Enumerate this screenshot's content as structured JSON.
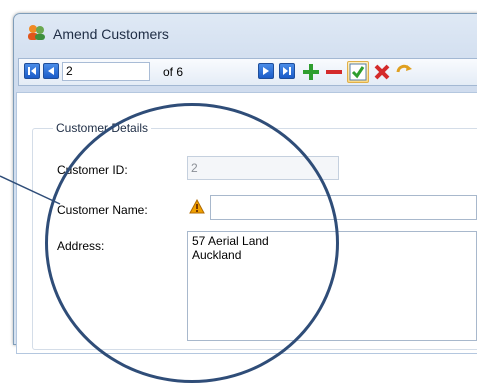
{
  "window": {
    "title": "Amend Customers"
  },
  "navigator": {
    "current_record": "2",
    "record_count_label": "of 6",
    "buttons": {
      "first": "first-record",
      "previous": "previous-record",
      "next": "next-record",
      "last": "last-record",
      "add": "add-record",
      "delete": "delete-record",
      "post": "post-edit",
      "cancel": "cancel-edit"
    }
  },
  "customer_details": {
    "group_title": "Customer Details",
    "id_label": "Customer ID:",
    "id_value": "2",
    "name_label": "Customer Name:",
    "name_value": "",
    "address_label": "Address:",
    "address_lines": [
      "57 Aerial Land",
      "Auckland"
    ]
  },
  "colors": {
    "callout": "#2f4d78",
    "nav_button": "#1b5cc8",
    "add_green": "#2e9e2e",
    "delete_red": "#d42a2a",
    "warning": "#f0a000"
  }
}
